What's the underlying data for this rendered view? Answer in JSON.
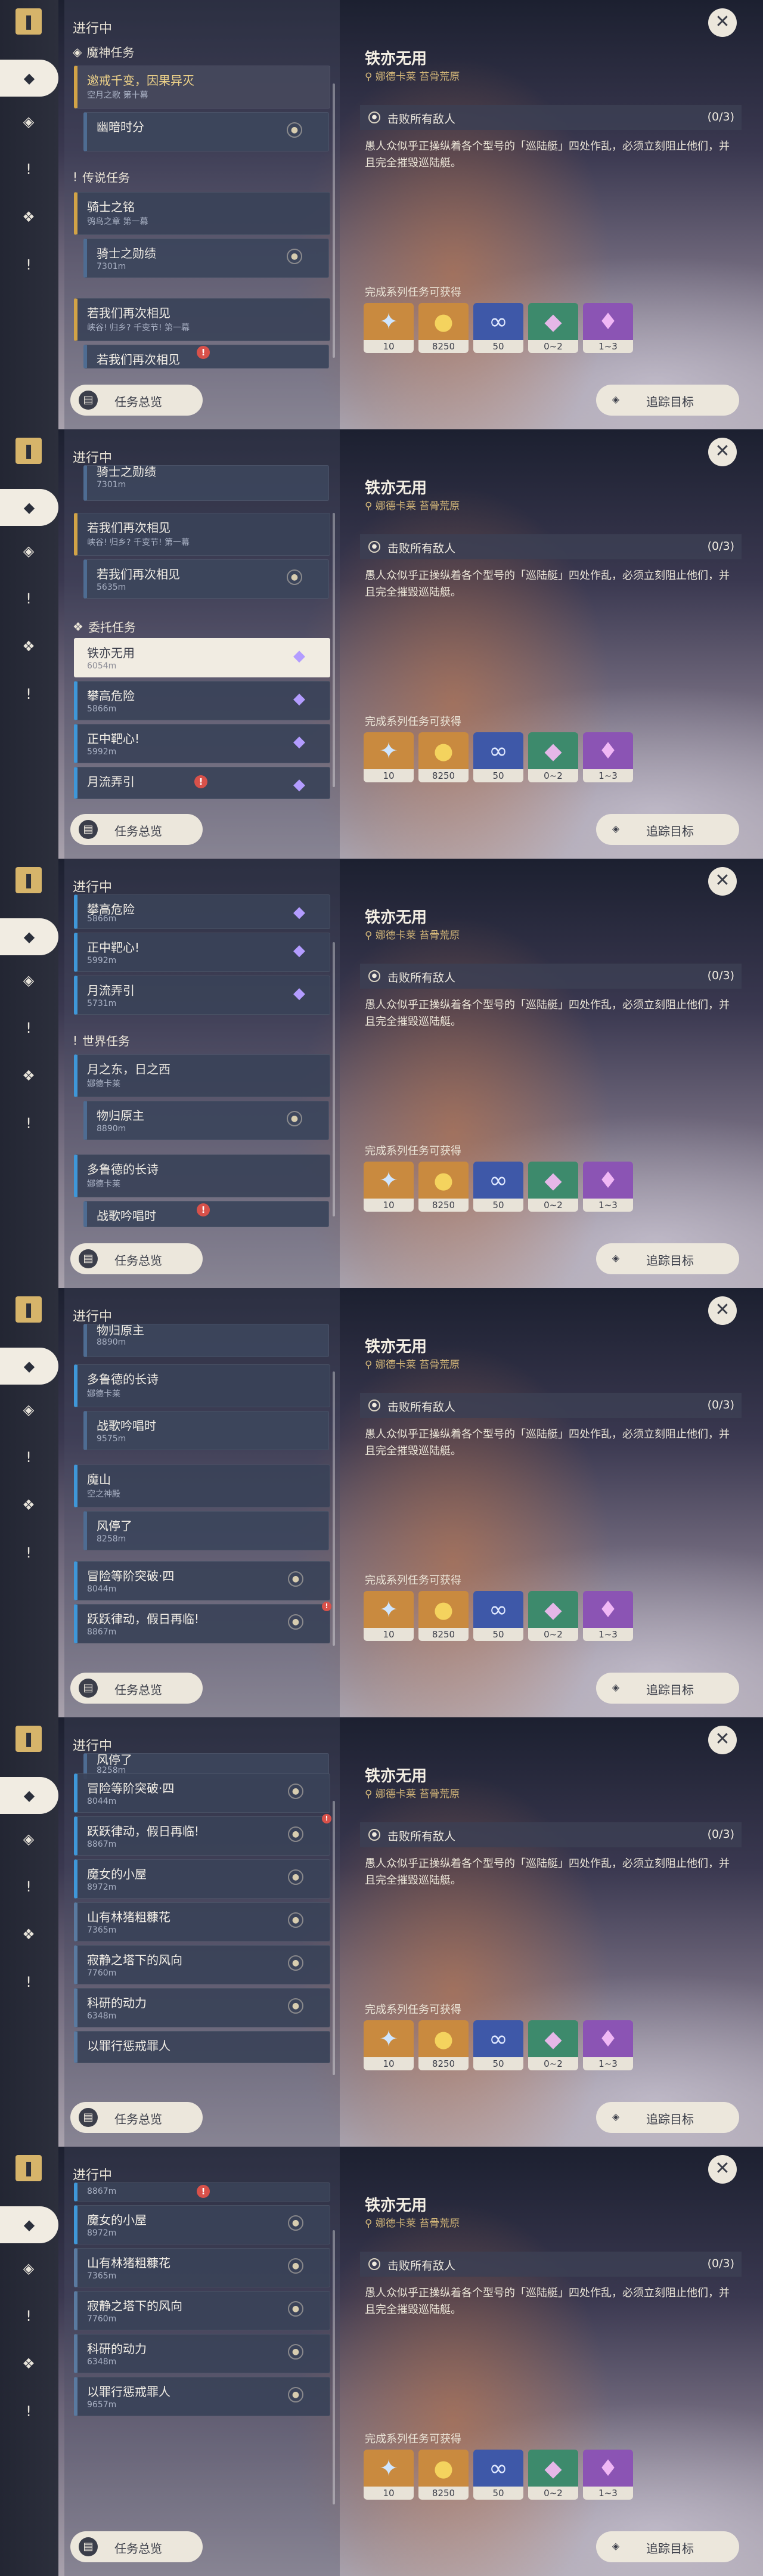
{
  "header": {
    "in_progress": "进行中"
  },
  "detail": {
    "title": "铁亦无用",
    "location": "娜德卡莱 苔骨荒原",
    "objective": "击败所有敌人",
    "objective_count": "(0/3)",
    "description": "愚人众似乎正操纵着各个型号的「巡陆艇」四处作乱，必须立刻阻止他们，并且完全摧毁巡陆艇。",
    "rewards_title": "完成系列任务可获得",
    "rewards": [
      {
        "icon": "adventure-exp-icon",
        "count": "10",
        "color": "#c98a3f"
      },
      {
        "icon": "mora-icon",
        "count": "8250",
        "color": "#c98a3f"
      },
      {
        "icon": "companionship-exp-icon",
        "count": "50",
        "color": "#3e58a8"
      },
      {
        "icon": "ore-icon",
        "count": "0~2",
        "color": "#3d8a6c"
      },
      {
        "icon": "crystal-icon",
        "count": "1~3",
        "color": "#8b54b4"
      }
    ]
  },
  "buttons": {
    "overview": "任务总览",
    "track": "追踪目标"
  },
  "sections": {
    "archon": "魔神任务",
    "legend": "传说任务",
    "commission": "委托任务",
    "world": "世界任务"
  },
  "quests": {
    "archon_main_title": "邀戒千变，因果异灭",
    "archon_main_sub": "空月之歌 第十幕",
    "archon_sub1": "幽暗时分",
    "legend1_title": "骑士之铭",
    "legend1_sub": "鸮鸟之章 第一幕",
    "legend1_step": "骑士之勋绩",
    "legend1_step_dist": "7301m",
    "legend2_title": "若我们再次相见",
    "legend2_sub": "峡谷! 归乡? 千变节! 第一幕",
    "legend2_step": "若我们再次相见",
    "legend2_step_dist": "5635m",
    "c1": "铁亦无用",
    "c1_dist": "6054m",
    "c2": "攀高危险",
    "c2_dist": "5866m",
    "c3": "正中靶心!",
    "c3_dist": "5992m",
    "c4": "月流弄引",
    "c4_dist": "5731m",
    "w1_title": "月之东，日之西",
    "w1_sub": "娜德卡莱",
    "w1_step": "物归原主",
    "w1_step_dist": "8890m",
    "w2_title": "多鲁德的长诗",
    "w2_sub": "娜德卡莱",
    "w2_step": "战歌吟唱时",
    "w2_step_dist": "9575m",
    "w3_title": "魔山",
    "w3_sub": "空之神殿",
    "w3_step": "风停了",
    "w3_step_dist": "8258m",
    "w4": "冒险等阶突破·四",
    "w4_dist": "8044m",
    "w5": "跃跃律动，假日再临!",
    "w5_dist": "8867m",
    "w6": "魔女的小屋",
    "w6_dist": "8972m",
    "w7": "山有林猪粗糠花",
    "w7_dist": "7365m",
    "w8": "寂静之塔下的风向",
    "w8_dist": "7760m",
    "w9": "科研的动力",
    "w9_dist": "6348m",
    "w10": "以罪行惩戒罪人",
    "w10_dist": "9657m"
  }
}
